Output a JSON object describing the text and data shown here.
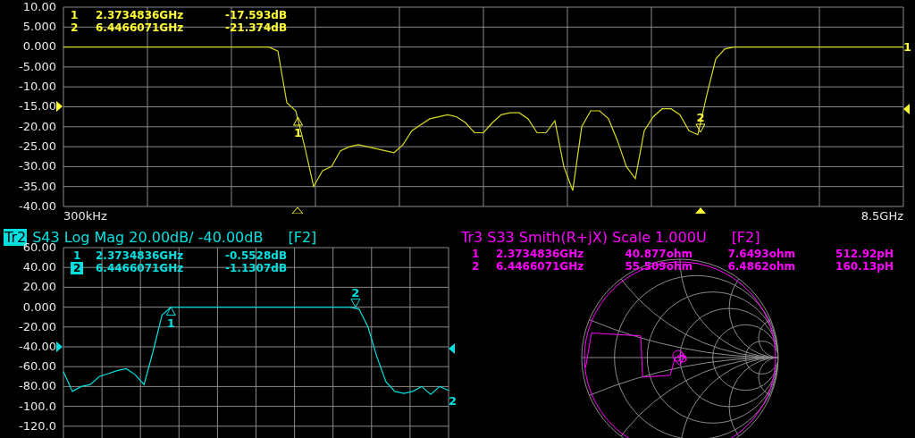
{
  "trace1": {
    "chart_data": {
      "type": "line",
      "grid": true,
      "categories": [
        null,
        null,
        null,
        null,
        null,
        null,
        null,
        null,
        null,
        null,
        null,
        null,
        null,
        null,
        null,
        null,
        null,
        null,
        null,
        null,
        null,
        null,
        null,
        null,
        null,
        null,
        null,
        null,
        null,
        null,
        null,
        null,
        null,
        null,
        null,
        null,
        null,
        null,
        null,
        null,
        null,
        null,
        null,
        null,
        null,
        null,
        null,
        null,
        null,
        null,
        null,
        null,
        null,
        null,
        null,
        null,
        null,
        null,
        null,
        null,
        null,
        null,
        null,
        null,
        null,
        null,
        null,
        null,
        null,
        null,
        null,
        null,
        null,
        null,
        null,
        null,
        null,
        null,
        null,
        null,
        null,
        null,
        null,
        null,
        null,
        null,
        null,
        null,
        null,
        null,
        null,
        null,
        null,
        null,
        null
      ],
      "series": [
        {
          "color": "#d8d820",
          "values": [
            0,
            0,
            0,
            0,
            0,
            0,
            0,
            0,
            0,
            0,
            0,
            0,
            0,
            0,
            0,
            0,
            0,
            0,
            0,
            0,
            0,
            0,
            0,
            0,
            -1,
            -14,
            -16,
            -25,
            -35,
            -31,
            -30,
            -26,
            -25,
            -24.5,
            -25,
            -25.5,
            -26,
            -26.5,
            -24.5,
            -21,
            -19.5,
            -18,
            -17.5,
            -17,
            -17.5,
            -19,
            -21.5,
            -21.5,
            -19,
            -17,
            -16.5,
            -16.5,
            -18,
            -21.5,
            -21.5,
            -18.5,
            -30,
            -36,
            -20,
            -16,
            -16,
            -18,
            -23.5,
            -30,
            -33,
            -21,
            -17.5,
            -15.5,
            -15.5,
            -17,
            -21,
            -22,
            -12,
            -3,
            -0.5,
            0,
            0,
            0,
            0,
            0,
            0,
            0,
            0,
            0,
            0,
            0,
            0,
            0,
            0,
            0,
            0,
            0,
            0,
            0,
            0
          ]
        }
      ],
      "ylim": [
        -40,
        10
      ],
      "yticks": [
        {
          "value": 10,
          "label": "10.00"
        },
        {
          "value": 5,
          "label": "5.000"
        },
        {
          "value": 0,
          "label": "0.000"
        },
        {
          "value": -5,
          "label": "-5.000"
        },
        {
          "value": -10,
          "label": "-10.00"
        },
        {
          "value": -15,
          "label": "-15.00"
        },
        {
          "value": -20,
          "label": "-20.00"
        },
        {
          "value": -25,
          "label": "-25.00"
        },
        {
          "value": -30,
          "label": "-30.00"
        },
        {
          "value": -35,
          "label": "-35.00"
        },
        {
          "value": -40,
          "label": "-40.00"
        }
      ]
    },
    "markers": [
      {
        "number": "1",
        "frequency": "2.3734836GHz",
        "value": "-17.593dB"
      },
      {
        "number": "2",
        "frequency": "6.4466071GHz",
        "value": "-21.374dB"
      }
    ],
    "plot_markers": [
      "1",
      "2"
    ],
    "end_label": "1",
    "start": "300kHz",
    "stop": "8.5GHz"
  },
  "trace2": {
    "title": "S43 Log Mag 20.00dB/ -40.00dB",
    "function_key": "[F2]",
    "markers": [
      {
        "number": "1",
        "frequency": "2.3734836GHz",
        "value": "-0.5528dB",
        "selected": false
      },
      {
        "number": "2",
        "frequency": "6.4466071GHz",
        "value": "-1.1307dB",
        "selected": true
      }
    ],
    "chart_data": {
      "type": "line",
      "grid": true,
      "categories": [
        null,
        null,
        null,
        null,
        null,
        null,
        null,
        null,
        null,
        null,
        null,
        null,
        null,
        null,
        null,
        null,
        null,
        null,
        null,
        null,
        null,
        null,
        null,
        null,
        null,
        null,
        null,
        null,
        null,
        null,
        null,
        null,
        null,
        null,
        null,
        null,
        null,
        null,
        null,
        null,
        null,
        null,
        null,
        null
      ],
      "series": [
        {
          "name": "Tr2",
          "color": "#00e0e0",
          "values": [
            -65,
            -85,
            -80,
            -78,
            -70,
            -67,
            -64,
            -62,
            -68,
            -78,
            -45,
            -8,
            0,
            0,
            0,
            0,
            0,
            0,
            0,
            0,
            0,
            0,
            0,
            0,
            0,
            0,
            0,
            0,
            0,
            0,
            0,
            0,
            0,
            -2,
            -20,
            -50,
            -75,
            -85,
            -87,
            -85,
            -80,
            -88,
            -80,
            -84
          ]
        }
      ],
      "ylim": [
        -140,
        60
      ],
      "yticks": [
        {
          "value": 60,
          "label": "60.00"
        },
        {
          "value": 40,
          "label": "40.00"
        },
        {
          "value": 20,
          "label": "20.00"
        },
        {
          "value": 0,
          "label": "0.000"
        },
        {
          "value": -20,
          "label": "-20.00"
        },
        {
          "value": -40,
          "label": "-40.00"
        },
        {
          "value": -60,
          "label": "-60.00"
        },
        {
          "value": -80,
          "label": "-80.00"
        },
        {
          "value": -100,
          "label": "-100.0"
        },
        {
          "value": -120,
          "label": "-120.0"
        }
      ]
    },
    "plot_markers": [
      "1",
      "2"
    ],
    "end_label": "2"
  },
  "trace3": {
    "title": "Tr3 S33 Smith(R+jX) Scale 1.000U",
    "function_key": "[F2]",
    "markers": [
      {
        "number": "1",
        "frequency": "2.3734836GHz",
        "resistance": "40.877ohm",
        "reactance": "7.6493ohm",
        "inductance": "512.92pH"
      },
      {
        "number": "2",
        "frequency": "6.4466071GHz",
        "resistance": "55.509ohm",
        "reactance": "6.4862ohm",
        "inductance": "160.13pH"
      }
    ]
  }
}
